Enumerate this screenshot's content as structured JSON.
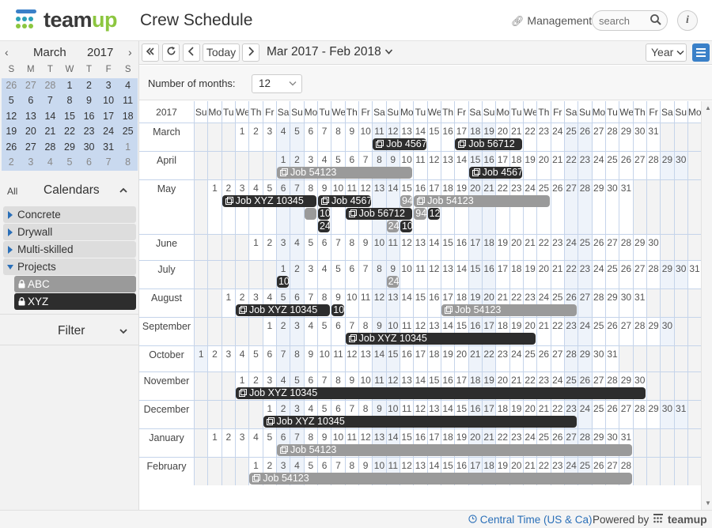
{
  "header": {
    "logo_team": "team",
    "logo_up": "up",
    "page_title": "Crew Schedule",
    "management_link": "Management",
    "search_placeholder": "search",
    "info_label": "i"
  },
  "mini_calendar": {
    "month": "March",
    "year": "2017",
    "weekdays": [
      "S",
      "M",
      "T",
      "W",
      "T",
      "F",
      "S"
    ],
    "weeks": [
      [
        "26",
        "27",
        "28",
        "1",
        "2",
        "3",
        "4"
      ],
      [
        "5",
        "6",
        "7",
        "8",
        "9",
        "10",
        "11"
      ],
      [
        "12",
        "13",
        "14",
        "15",
        "16",
        "17",
        "18"
      ],
      [
        "19",
        "20",
        "21",
        "22",
        "23",
        "24",
        "25"
      ],
      [
        "26",
        "27",
        "28",
        "29",
        "30",
        "31",
        "1"
      ],
      [
        "2",
        "3",
        "4",
        "5",
        "6",
        "7",
        "8"
      ]
    ]
  },
  "calendars": {
    "all_label": "All",
    "title": "Calendars",
    "items": [
      {
        "label": "Concrete",
        "expanded": false
      },
      {
        "label": "Drywall",
        "expanded": false
      },
      {
        "label": "Multi-skilled",
        "expanded": false
      },
      {
        "label": "Projects",
        "expanded": true
      }
    ],
    "sub_items": [
      {
        "label": "ABC",
        "color": "#9a9a9a"
      },
      {
        "label": "XYZ",
        "color": "#2d2d2d"
      }
    ]
  },
  "filter_label": "Filter",
  "toolbar": {
    "today_label": "Today",
    "range_title": "Mar 2017 - Feb 2018",
    "view_label": "Year"
  },
  "options": {
    "months_label": "Number of months:",
    "months_value": "12"
  },
  "grid": {
    "corner_label": "2017",
    "dow_header": [
      "Su",
      "Mo",
      "Tu",
      "We",
      "Th",
      "Fr",
      "Sa",
      "Su",
      "Mo",
      "Tu",
      "We",
      "Th",
      "Fr",
      "Sa",
      "Su",
      "Mo",
      "Tu",
      "We",
      "Th",
      "Fr",
      "Sa",
      "Su",
      "Mo",
      "Tu",
      "We",
      "Th",
      "Fr",
      "Sa",
      "Su",
      "Mo",
      "Tu",
      "We",
      "Th",
      "Fr",
      "Sa",
      "Su",
      "Mo"
    ],
    "months": [
      {
        "name": "March",
        "start": 3,
        "days": 31
      },
      {
        "name": "April",
        "start": 6,
        "days": 30
      },
      {
        "name": "May",
        "start": 1,
        "days": 31
      },
      {
        "name": "June",
        "start": 4,
        "days": 30
      },
      {
        "name": "July",
        "start": 6,
        "days": 31
      },
      {
        "name": "August",
        "start": 2,
        "days": 31
      },
      {
        "name": "September",
        "start": 5,
        "days": 30
      },
      {
        "name": "October",
        "start": 0,
        "days": 31
      },
      {
        "name": "November",
        "start": 3,
        "days": 30
      },
      {
        "name": "December",
        "start": 5,
        "days": 31
      },
      {
        "name": "January",
        "start": 1,
        "days": 31
      },
      {
        "name": "February",
        "start": 4,
        "days": 28
      }
    ],
    "events": [
      {
        "month": 0,
        "lane": 0,
        "from": 11,
        "to": 14,
        "label": "Job 4567",
        "tone": "dark"
      },
      {
        "month": 0,
        "lane": 0,
        "from": 17,
        "to": 21,
        "label": "Job 56712",
        "tone": "dark"
      },
      {
        "month": 1,
        "lane": 0,
        "from": 1,
        "to": 10,
        "label": "Job 54123",
        "tone": "gray"
      },
      {
        "month": 1,
        "lane": 0,
        "from": 15,
        "to": 18,
        "label": "Job 4567",
        "tone": "dark"
      },
      {
        "month": 2,
        "lane": 0,
        "from": 2,
        "to": 8,
        "label": "Job XYZ 10345",
        "tone": "dark"
      },
      {
        "month": 2,
        "lane": 0,
        "from": 9,
        "to": 12,
        "label": "Job 4567",
        "tone": "dark"
      },
      {
        "month": 2,
        "lane": 0,
        "from": 15,
        "to": 15,
        "label": "94",
        "tone": "gray"
      },
      {
        "month": 2,
        "lane": 0,
        "from": 16,
        "to": 25,
        "label": "Job 54123",
        "tone": "gray"
      },
      {
        "month": 2,
        "lane": 1,
        "from": 8,
        "to": 8,
        "label": "",
        "tone": "gray"
      },
      {
        "month": 2,
        "lane": 1,
        "from": 9,
        "to": 9,
        "label": "10",
        "tone": "dark"
      },
      {
        "month": 2,
        "lane": 1,
        "from": 11,
        "to": 15,
        "label": "Job 56712",
        "tone": "dark"
      },
      {
        "month": 2,
        "lane": 1,
        "from": 16,
        "to": 16,
        "label": "94",
        "tone": "gray"
      },
      {
        "month": 2,
        "lane": 1,
        "from": 17,
        "to": 17,
        "label": "12",
        "tone": "dark"
      },
      {
        "month": 2,
        "lane": 2,
        "from": 9,
        "to": 9,
        "label": "24",
        "tone": "dark"
      },
      {
        "month": 2,
        "lane": 2,
        "from": 14,
        "to": 14,
        "label": "24",
        "tone": "gray"
      },
      {
        "month": 2,
        "lane": 2,
        "from": 15,
        "to": 15,
        "label": "10",
        "tone": "dark"
      },
      {
        "month": 4,
        "lane": 0,
        "from": 1,
        "to": 1,
        "label": "10",
        "tone": "dark"
      },
      {
        "month": 4,
        "lane": 0,
        "from": 9,
        "to": 9,
        "label": "24",
        "tone": "gray"
      },
      {
        "month": 5,
        "lane": 0,
        "from": 2,
        "to": 8,
        "label": "Job XYZ 10345",
        "tone": "dark"
      },
      {
        "month": 5,
        "lane": 0,
        "from": 9,
        "to": 9,
        "label": "10",
        "tone": "dark"
      },
      {
        "month": 5,
        "lane": 0,
        "from": 17,
        "to": 26,
        "label": "Job 54123",
        "tone": "gray"
      },
      {
        "month": 6,
        "lane": 0,
        "from": 7,
        "to": 20,
        "label": "Job XYZ 10345",
        "tone": "dark"
      },
      {
        "month": 8,
        "lane": 0,
        "from": 1,
        "to": 30,
        "label": "Job XYZ 10345",
        "tone": "dark"
      },
      {
        "month": 9,
        "lane": 0,
        "from": 1,
        "to": 23,
        "label": "Job XYZ 10345",
        "tone": "dark"
      },
      {
        "month": 10,
        "lane": 0,
        "from": 6,
        "to": 31,
        "label": "Job 54123",
        "tone": "gray"
      },
      {
        "month": 11,
        "lane": 0,
        "from": 1,
        "to": 28,
        "label": "Job 54123",
        "tone": "gray"
      }
    ]
  },
  "footer": {
    "timezone": "Central Time (US & Ca)",
    "powered_by": "Powered by",
    "powered_logo": "teamup"
  }
}
